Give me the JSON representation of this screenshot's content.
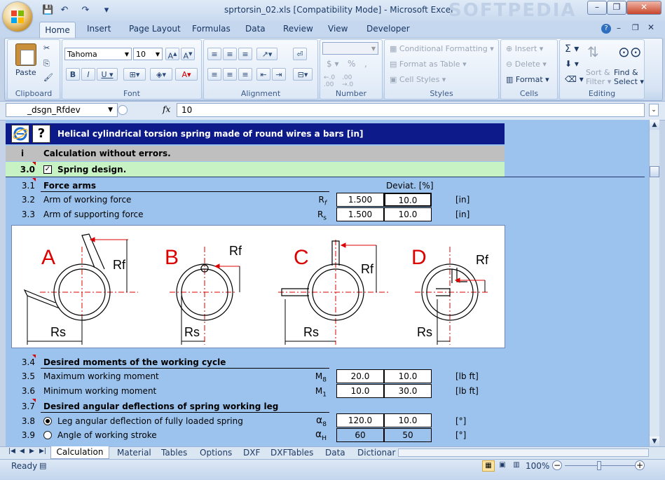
{
  "window": {
    "title": "sprtorsin_02.xls  [Compatibility Mode] - Microsoft Excel",
    "watermark": "SOFTPEDIA",
    "controls": {
      "minimize": "–",
      "restore": "❐",
      "close": "✕"
    }
  },
  "ribbon": {
    "tabs": [
      "Home",
      "Insert",
      "Page Layout",
      "Formulas",
      "Data",
      "Review",
      "View",
      "Developer"
    ],
    "clipboard": {
      "paste": "Paste",
      "group": "Clipboard"
    },
    "font": {
      "name": "Tahoma",
      "size": "10",
      "group": "Font"
    },
    "alignment": {
      "group": "Alignment"
    },
    "number": {
      "group": "Number"
    },
    "styles": {
      "conditional": "Conditional Formatting",
      "table": "Format as Table",
      "cell": "Cell Styles",
      "group": "Styles"
    },
    "cells": {
      "insert": "Insert",
      "delete": "Delete",
      "format": "Format",
      "group": "Cells"
    },
    "editing": {
      "sort": "Sort &",
      "filter": "Filter",
      "find": "Find &",
      "select": "Select",
      "group": "Editing"
    }
  },
  "formula_bar": {
    "name_box": "_dsgn_Rfdev",
    "fx": "fx",
    "value": "10"
  },
  "sheet": {
    "title": "Helical cylindrical torsion spring made of round wires a bars [in]",
    "help_icon": "?",
    "status": {
      "num": "i",
      "text": "Calculation without errors."
    },
    "design": {
      "num": "3.0",
      "text": "Spring design."
    },
    "r31": {
      "num": "3.1",
      "text": "Force arms",
      "dev_header": "Deviat. [%]"
    },
    "r32": {
      "num": "3.2",
      "text": "Arm of working force",
      "sym": "R",
      "sub": "f",
      "val": "1.500",
      "dev": "10.0",
      "unit": "[in]"
    },
    "r33": {
      "num": "3.3",
      "text": "Arm of supporting force",
      "sym": "R",
      "sub": "s",
      "val": "1.500",
      "dev": "10.0",
      "unit": "[in]"
    },
    "diagram": {
      "labels": [
        "A",
        "B",
        "C",
        "D"
      ],
      "rf": "Rf",
      "rs": "Rs"
    },
    "r34": {
      "num": "3.4",
      "text": "Desired moments of the working cycle"
    },
    "r35": {
      "num": "3.5",
      "text": "Maximum working moment",
      "sym": "M",
      "sub": "8",
      "val": "20.0",
      "dev": "10.0",
      "unit": "[lb ft]"
    },
    "r36": {
      "num": "3.6",
      "text": "Minimum working moment",
      "sym": "M",
      "sub": "1",
      "val": "10.0",
      "dev": "30.0",
      "unit": "[lb ft]"
    },
    "r37": {
      "num": "3.7",
      "text": "Desired angular deflections of spring working leg"
    },
    "r38": {
      "num": "3.8",
      "text": "Leg angular deflection of fully loaded spring",
      "sym": "α",
      "sub": "8",
      "val": "120.0",
      "dev": "10.0",
      "unit": "[°]"
    },
    "r39": {
      "num": "3.9",
      "text": "Angle of working stroke",
      "sym": "α",
      "sub": "H",
      "val": "60",
      "dev": "50",
      "unit": "[°]"
    }
  },
  "sheet_tabs": [
    "Calculation",
    "Material",
    "Tables",
    "Options",
    "DXF",
    "DXFTables",
    "Data",
    "Dictionar"
  ],
  "status_bar": {
    "ready": "Ready",
    "zoom": "100%"
  }
}
